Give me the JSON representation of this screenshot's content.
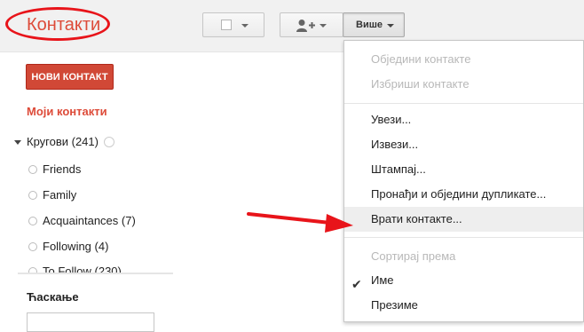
{
  "header": {
    "app_title": "Контакти",
    "more_label": "Више"
  },
  "sidebar": {
    "new_contact": "НОВИ КОНТАКТ",
    "my_contacts": "Моји контакти",
    "circles_label": "Кругови (241)",
    "circles": [
      {
        "label": "Friends"
      },
      {
        "label": "Family"
      },
      {
        "label": "Acquaintances (7)"
      },
      {
        "label": "Following (4)"
      },
      {
        "label": "To Follow (230)"
      }
    ],
    "chat_title": "Ћаскање"
  },
  "more_menu": {
    "merge_contacts": "Обједини контакте",
    "delete_contacts": "Избриши контакте",
    "import": "Увези...",
    "export": "Извези...",
    "print": "Штампај...",
    "find_duplicates": "Пронађи и обједини дупликате...",
    "restore_contacts": "Врати контакте...",
    "sort_by": "Сортирај према",
    "sort_first_name": "Име",
    "sort_last_name": "Презиме"
  },
  "colors": {
    "accent": "#dd4b39",
    "annotation": "#e8141a"
  },
  "icons": {
    "add_person": "add-person-icon",
    "checkmark": "checkmark-icon"
  }
}
